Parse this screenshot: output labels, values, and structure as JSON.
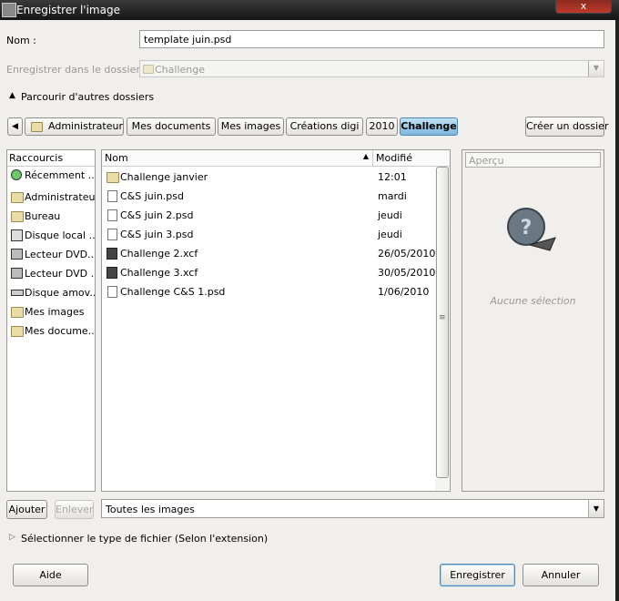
{
  "window": {
    "title": "Enregistrer l'image",
    "close": "x"
  },
  "name_row": {
    "label": "Nom :",
    "value": "template juin.psd"
  },
  "folder_row": {
    "label": "Enregistrer dans le dossier :",
    "value": "Challenge"
  },
  "browse": {
    "label": "Parcourir d'autres dossiers"
  },
  "path_bar": {
    "back": "◀",
    "items": [
      "Administrateur",
      "Mes documents",
      "Mes images",
      "Créations digi",
      "2010",
      "Challenge"
    ],
    "create_folder": "Créer un dossier"
  },
  "places": {
    "header": "Raccourcis",
    "items": [
      "Récemment ...",
      "Administrateur",
      "Bureau",
      "Disque local ...",
      "Lecteur DVD...",
      "Lecteur DVD ...",
      "Disque amov...",
      "Mes images",
      "Mes docume..."
    ],
    "add_button": "Ajouter",
    "remove_button": "Enlever"
  },
  "files": {
    "col_name": "Nom",
    "col_modified": "Modifié",
    "rows": [
      {
        "name": "Challenge janvier",
        "modified": "12:01",
        "type": "folder"
      },
      {
        "name": "C&S juin.psd",
        "modified": "mardi",
        "type": "file"
      },
      {
        "name": "C&S juin 2.psd",
        "modified": "jeudi",
        "type": "file"
      },
      {
        "name": "C&S juin 3.psd",
        "modified": "jeudi",
        "type": "file"
      },
      {
        "name": "Challenge 2.xcf",
        "modified": "26/05/2010",
        "type": "xcf"
      },
      {
        "name": "Challenge 3.xcf",
        "modified": "30/05/2010",
        "type": "xcf"
      },
      {
        "name": "Challenge C&S 1.psd",
        "modified": "1/06/2010",
        "type": "file"
      }
    ]
  },
  "preview": {
    "header": "Aperçu",
    "empty": "Aucune sélection"
  },
  "filter": {
    "value": "Toutes les images"
  },
  "file_type": {
    "label": "Sélectionner le type de fichier (Selon l'extension)"
  },
  "buttons": {
    "help": "Aide",
    "save": "Enregistrer",
    "cancel": "Annuler"
  }
}
